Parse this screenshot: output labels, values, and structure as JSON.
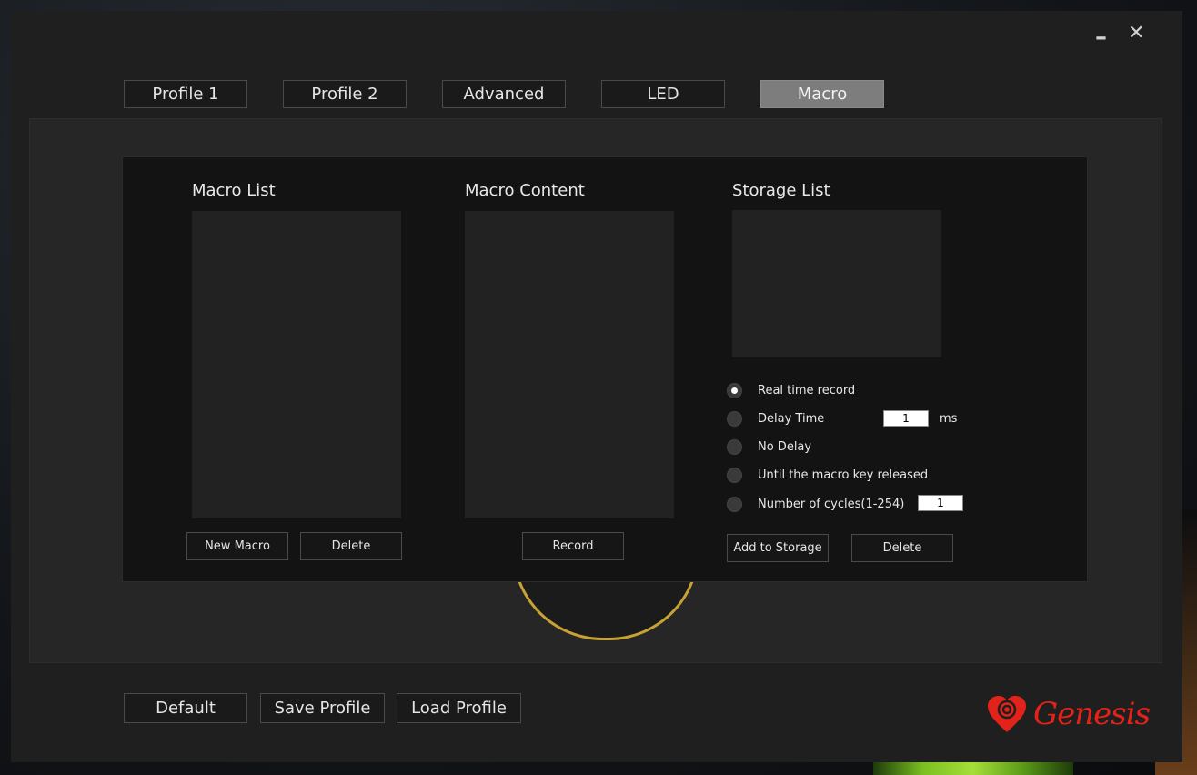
{
  "window": {
    "minimize_icon": "minus-icon",
    "close_icon": "close-icon"
  },
  "tabs": [
    {
      "label": "Profile 1",
      "active": false
    },
    {
      "label": "Profile 2",
      "active": false
    },
    {
      "label": "Advanced",
      "active": false
    },
    {
      "label": "LED",
      "active": false
    },
    {
      "label": "Macro",
      "active": true
    }
  ],
  "macro_list": {
    "title": "Macro List",
    "items": [],
    "new_button": "New Macro",
    "delete_button": "Delete"
  },
  "macro_content": {
    "title": "Macro Content",
    "items": [],
    "record_button": "Record"
  },
  "storage_list": {
    "title": "Storage List",
    "items": [],
    "add_button": "Add to Storage",
    "delete_button": "Delete"
  },
  "options": {
    "real_time": "Real time record",
    "delay_time": "Delay Time",
    "delay_value": "1",
    "delay_unit": "ms",
    "no_delay": "No Delay",
    "until_released": "Until the macro key released",
    "cycles": "Number of cycles(1-254)",
    "cycles_value": "1",
    "selected_timing": "real_time"
  },
  "footer": {
    "default_button": "Default",
    "save_button": "Save Profile",
    "load_button": "Load Profile",
    "brand": "Genesis"
  },
  "colors": {
    "brand_red": "#e2231a",
    "active_tab": "#7d7d7d"
  }
}
